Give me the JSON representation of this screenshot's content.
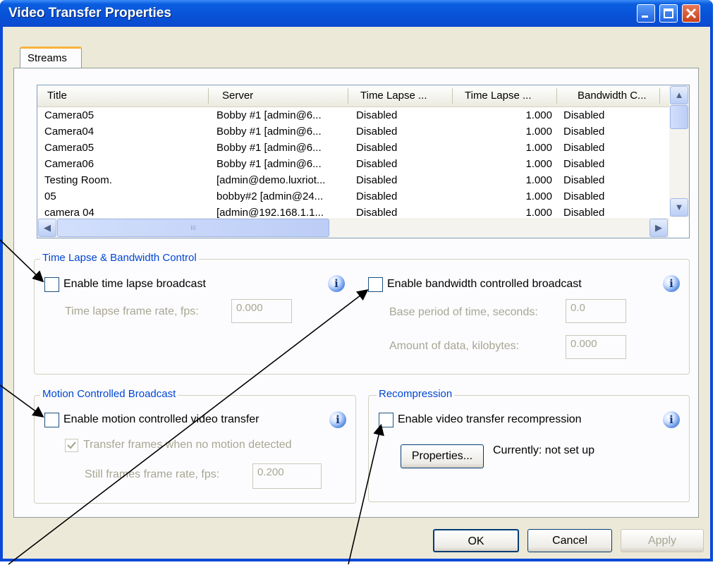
{
  "window": {
    "title": "Video Transfer Properties"
  },
  "tab": {
    "label": "Streams"
  },
  "streams": {
    "columns": [
      "Title",
      "Server",
      "Time Lapse ...",
      "Time Lapse ...",
      "Bandwidth C..."
    ],
    "rows": [
      [
        "Camera05",
        "Bobby #1 [admin@6...",
        "Disabled",
        "1.000",
        "Disabled"
      ],
      [
        "Camera04",
        "Bobby #1 [admin@6...",
        "Disabled",
        "1.000",
        "Disabled"
      ],
      [
        "Camera05",
        "Bobby #1 [admin@6...",
        "Disabled",
        "1.000",
        "Disabled"
      ],
      [
        "Camera06",
        "Bobby #1 [admin@6...",
        "Disabled",
        "1.000",
        "Disabled"
      ],
      [
        "Testing Room.",
        "[admin@demo.luxriot...",
        "Disabled",
        "1.000",
        "Disabled"
      ],
      [
        "05",
        "bobby#2 [admin@24...",
        "Disabled",
        "1.000",
        "Disabled"
      ],
      [
        "camera 04",
        "[admin@192.168.1.1...",
        "Disabled",
        "1.000",
        "Disabled"
      ]
    ]
  },
  "time_lapse_group": {
    "label": "Time Lapse & Bandwidth Control",
    "enable_time_lapse": {
      "label": "Enable time lapse broadcast",
      "checked": false
    },
    "frame_rate": {
      "label": "Time lapse frame rate, fps:",
      "value": "0.000"
    },
    "enable_bandwidth": {
      "label": "Enable bandwidth controlled broadcast",
      "checked": false
    },
    "base_period": {
      "label": "Base period of time, seconds:",
      "value": "0.0"
    },
    "amount_data": {
      "label": "Amount of data, kilobytes:",
      "value": "0.000"
    }
  },
  "motion_group": {
    "label": "Motion Controlled Broadcast",
    "enable_motion": {
      "label": "Enable motion controlled video transfer",
      "checked": false
    },
    "transfer_frames": {
      "label": "Transfer frames when no motion detected",
      "checked": true
    },
    "still_rate": {
      "label": "Still frames frame rate, fps:",
      "value": "0.200"
    }
  },
  "recompression_group": {
    "label": "Recompression",
    "enable_recompression": {
      "label": "Enable video transfer recompression",
      "checked": false
    },
    "properties_button": "Properties...",
    "status": "Currently: not set up"
  },
  "buttons": {
    "ok": "OK",
    "cancel": "Cancel",
    "apply": "Apply"
  },
  "info_icon_glyph": "i",
  "scroll": {
    "left_arrow": "◀",
    "right_arrow": "▶",
    "up_arrow": "▲",
    "down_arrow": "▼",
    "grip": "III"
  },
  "colors": {
    "title_bar": "#0a4ad8",
    "group_label": "#0046d5",
    "disabled_text": "#a8a693",
    "client_bg": "#ece9d8"
  }
}
